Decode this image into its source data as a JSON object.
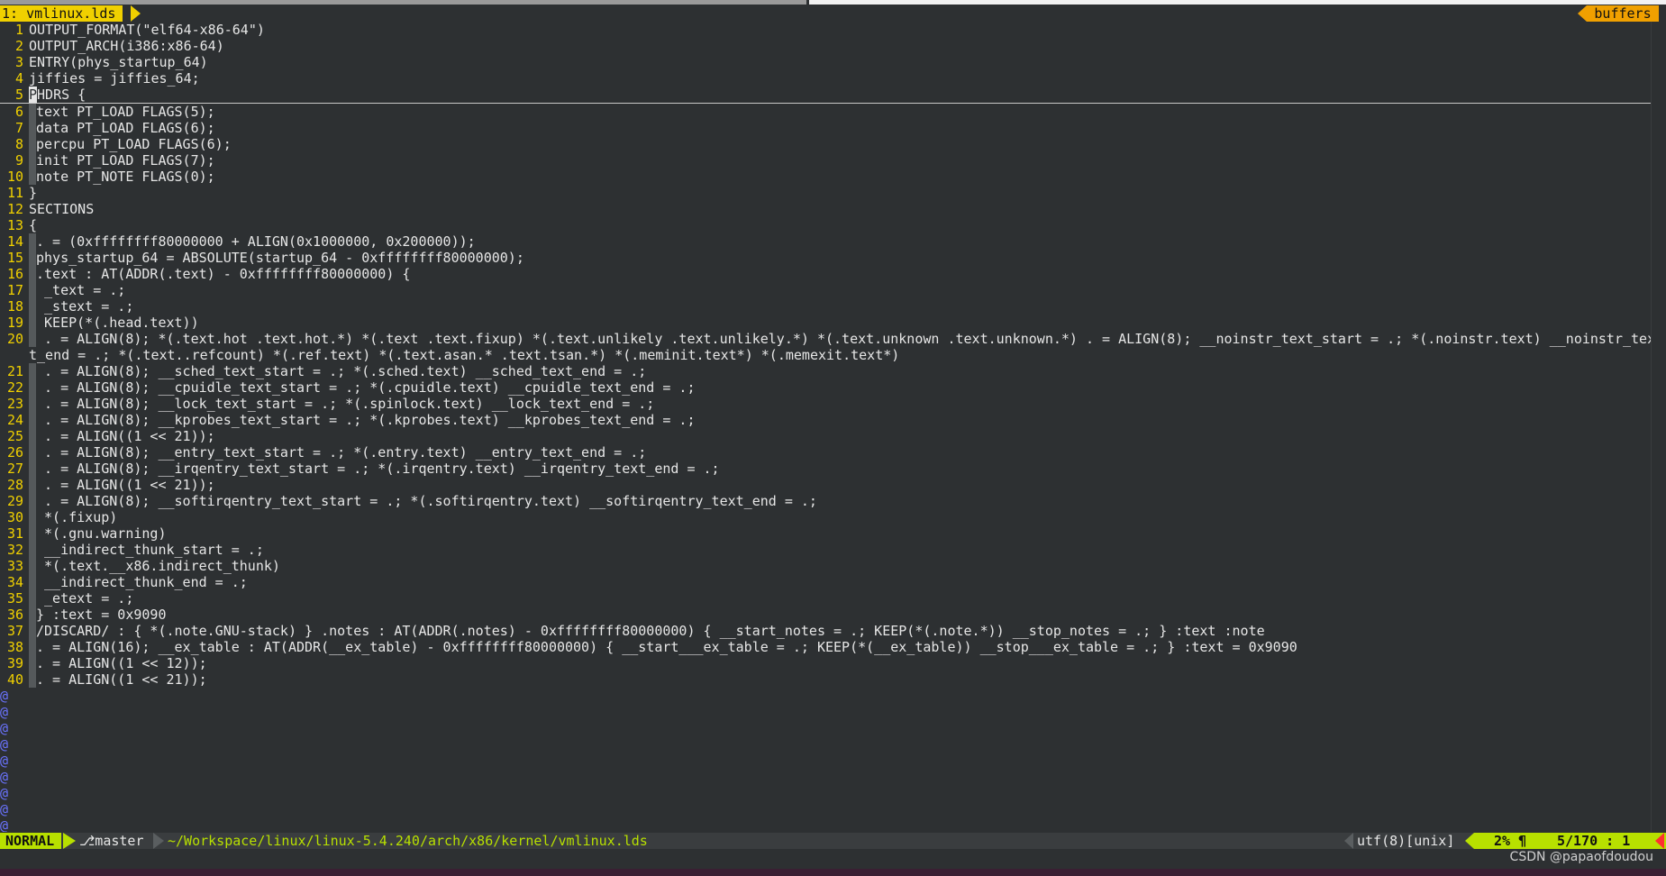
{
  "tab": {
    "active_label": "1: vmlinux.lds",
    "buffers_label": "buffers"
  },
  "lines": [
    {
      "n": "1",
      "indent": 0,
      "text": "OUTPUT_FORMAT(\"elf64-x86-64\")"
    },
    {
      "n": "2",
      "indent": 0,
      "text": "OUTPUT_ARCH(i386:x86-64)"
    },
    {
      "n": "3",
      "indent": 0,
      "text": "ENTRY(phys_startup_64)"
    },
    {
      "n": "4",
      "indent": 0,
      "text": "jiffies = jiffies_64;"
    },
    {
      "n": "5",
      "indent": 0,
      "text": "PHDRS {",
      "cursor": true
    },
    {
      "n": "6",
      "indent": 1,
      "text": "text PT_LOAD FLAGS(5);"
    },
    {
      "n": "7",
      "indent": 1,
      "text": "data PT_LOAD FLAGS(6);"
    },
    {
      "n": "8",
      "indent": 1,
      "text": "percpu PT_LOAD FLAGS(6);"
    },
    {
      "n": "9",
      "indent": 1,
      "text": "init PT_LOAD FLAGS(7);"
    },
    {
      "n": "10",
      "indent": 1,
      "text": "note PT_NOTE FLAGS(0);"
    },
    {
      "n": "11",
      "indent": 0,
      "text": "}"
    },
    {
      "n": "12",
      "indent": 0,
      "text": "SECTIONS"
    },
    {
      "n": "13",
      "indent": 0,
      "text": "{"
    },
    {
      "n": "14",
      "indent": 1,
      "text": ". = (0xffffffff80000000 + ALIGN(0x1000000, 0x200000));"
    },
    {
      "n": "15",
      "indent": 1,
      "text": "phys_startup_64 = ABSOLUTE(startup_64 - 0xffffffff80000000);"
    },
    {
      "n": "16",
      "indent": 1,
      "text": ".text : AT(ADDR(.text) - 0xffffffff80000000) {"
    },
    {
      "n": "17",
      "indent": 1,
      "text": " _text = .;"
    },
    {
      "n": "18",
      "indent": 1,
      "text": " _stext = .;"
    },
    {
      "n": "19",
      "indent": 1,
      "text": " KEEP(*(.head.text))"
    },
    {
      "n": "20",
      "indent": 1,
      "text": " . = ALIGN(8); *(.text.hot .text.hot.*) *(.text .text.fixup) *(.text.unlikely .text.unlikely.*) *(.text.unknown .text.unknown.*) . = ALIGN(8); __noinstr_text_start = .; *(.noinstr.text) __noinstr_tex"
    },
    {
      "n": "",
      "indent": 0,
      "text": "t_end = .; *(.text..refcount) *(.ref.text) *(.text.asan.* .text.tsan.*) *(.meminit.text*) *(.memexit.text*)",
      "wrap": true
    },
    {
      "n": "21",
      "indent": 1,
      "text": " . = ALIGN(8); __sched_text_start = .; *(.sched.text) __sched_text_end = .;"
    },
    {
      "n": "22",
      "indent": 1,
      "text": " . = ALIGN(8); __cpuidle_text_start = .; *(.cpuidle.text) __cpuidle_text_end = .;"
    },
    {
      "n": "23",
      "indent": 1,
      "text": " . = ALIGN(8); __lock_text_start = .; *(.spinlock.text) __lock_text_end = .;"
    },
    {
      "n": "24",
      "indent": 1,
      "text": " . = ALIGN(8); __kprobes_text_start = .; *(.kprobes.text) __kprobes_text_end = .;"
    },
    {
      "n": "25",
      "indent": 1,
      "text": " . = ALIGN((1 << 21));"
    },
    {
      "n": "26",
      "indent": 1,
      "text": " . = ALIGN(8); __entry_text_start = .; *(.entry.text) __entry_text_end = .;"
    },
    {
      "n": "27",
      "indent": 1,
      "text": " . = ALIGN(8); __irqentry_text_start = .; *(.irqentry.text) __irqentry_text_end = .;"
    },
    {
      "n": "28",
      "indent": 1,
      "text": " . = ALIGN((1 << 21));"
    },
    {
      "n": "29",
      "indent": 1,
      "text": " . = ALIGN(8); __softirqentry_text_start = .; *(.softirqentry.text) __softirqentry_text_end = .;"
    },
    {
      "n": "30",
      "indent": 1,
      "text": " *(.fixup)"
    },
    {
      "n": "31",
      "indent": 1,
      "text": " *(.gnu.warning)"
    },
    {
      "n": "32",
      "indent": 1,
      "text": " __indirect_thunk_start = .;"
    },
    {
      "n": "33",
      "indent": 1,
      "text": " *(.text.__x86.indirect_thunk)"
    },
    {
      "n": "34",
      "indent": 1,
      "text": " __indirect_thunk_end = .;"
    },
    {
      "n": "35",
      "indent": 1,
      "text": " _etext = .;"
    },
    {
      "n": "36",
      "indent": 1,
      "text": "} :text = 0x9090"
    },
    {
      "n": "37",
      "indent": 1,
      "text": "/DISCARD/ : { *(.note.GNU-stack) } .notes : AT(ADDR(.notes) - 0xffffffff80000000) { __start_notes = .; KEEP(*(.note.*)) __stop_notes = .; } :text :note"
    },
    {
      "n": "38",
      "indent": 1,
      "text": ". = ALIGN(16); __ex_table : AT(ADDR(__ex_table) - 0xffffffff80000000) { __start___ex_table = .; KEEP(*(__ex_table)) __stop___ex_table = .; } :text = 0x9090"
    },
    {
      "n": "39",
      "indent": 1,
      "text": ". = ALIGN((1 << 12));"
    },
    {
      "n": "40",
      "indent": 1,
      "text": ". = ALIGN((1 << 21));"
    }
  ],
  "empty_marker": "@",
  "empty_rows": 9,
  "status": {
    "mode": "NORMAL",
    "branch": "⎇master",
    "filepath": "~/Workspace/linux/linux-5.4.240/arch/x86/kernel/vmlinux.lds",
    "encoding": "utf(8)[unix]",
    "percent": "2% ¶",
    "position": "5/170 :  1"
  },
  "watermark": "CSDN @papaofdoudou",
  "colors": {
    "tab_active": "#f0d000",
    "buffers": "#f0a000",
    "mode_bg": "#b8e000",
    "line_number": "#f0d000",
    "editor_bg": "#2d3032",
    "tilde": "#6a73ff"
  }
}
